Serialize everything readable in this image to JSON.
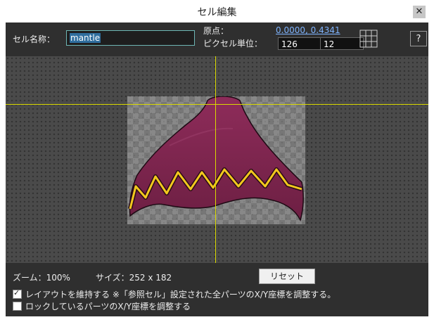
{
  "window": {
    "title": "セル編集",
    "close_icon": "✕"
  },
  "toolbar": {
    "cell_name_label": "セル名称：",
    "cell_name_value": "mantle",
    "origin_label": "原点：",
    "origin_value": "0.0000, 0.4341",
    "pixel_unit_label": "ピクセル単位：",
    "pixel_unit_x": "126",
    "pixel_unit_y": "12",
    "grid_icon": "grid-icon",
    "help_label": "?"
  },
  "canvas": {
    "guide_color": "#d9d900",
    "part_fill": "#8a2a55",
    "zigzag_color": "#f2c81e"
  },
  "status": {
    "zoom_label": "ズーム：100%",
    "size_label": "サイズ：252 x 182",
    "reset_label": "リセット",
    "keep_layout_label": "レイアウトを維持する ※「参照セル」設定された全パーツのX/Y座標を調整する。",
    "keep_layout_checked": true,
    "locked_parts_label": "ロックしているパーツのX/Y座標を調整する",
    "locked_parts_checked": false
  }
}
